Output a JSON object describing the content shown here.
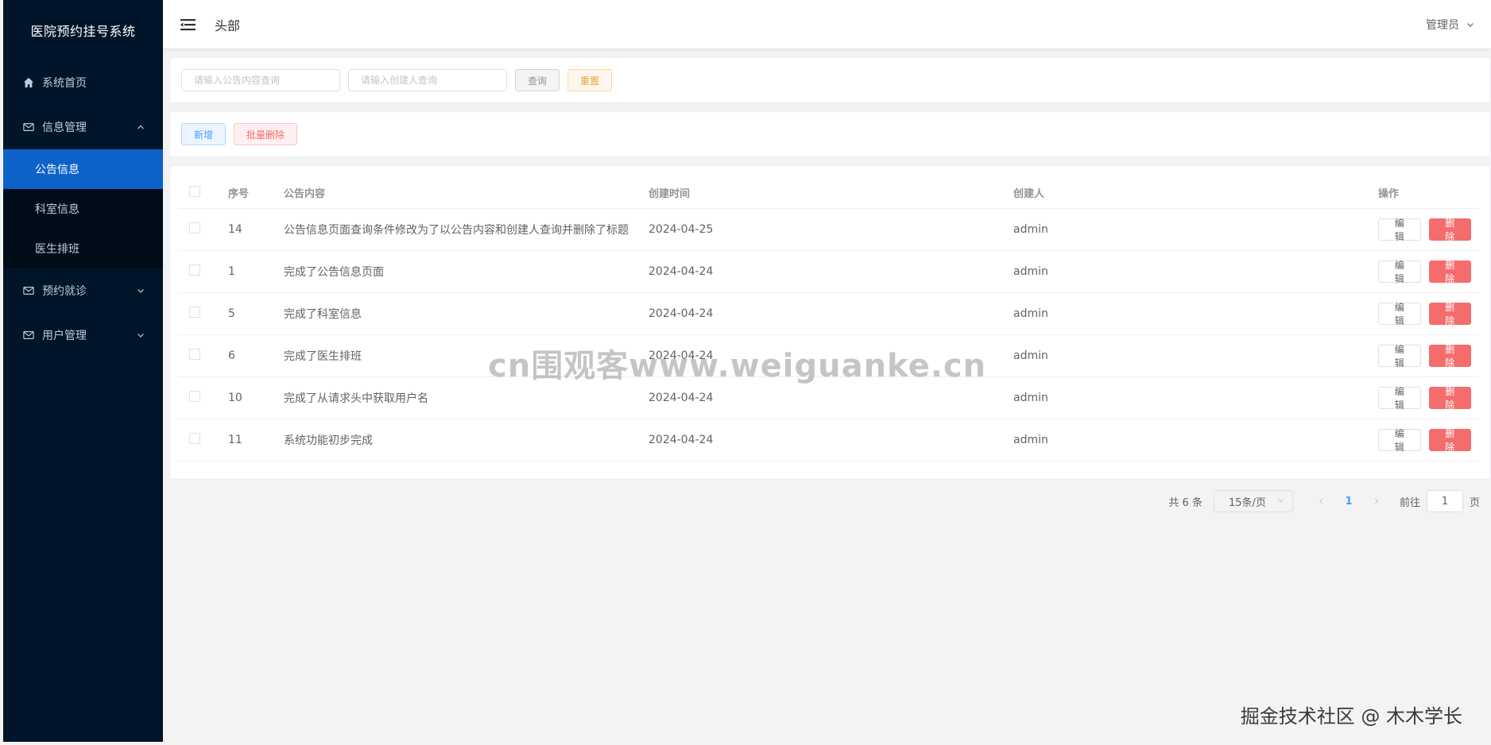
{
  "app": {
    "title": "医院预约挂号系统"
  },
  "sidebar": {
    "items": [
      {
        "label": "系统首页",
        "icon": "home-icon"
      },
      {
        "label": "信息管理",
        "icon": "mail-icon",
        "expanded": true,
        "children": [
          {
            "label": "公告信息",
            "active": true
          },
          {
            "label": "科室信息",
            "active": false
          },
          {
            "label": "医生排班",
            "active": false
          }
        ]
      },
      {
        "label": "预约就诊",
        "icon": "mail-icon",
        "expanded": false
      },
      {
        "label": "用户管理",
        "icon": "mail-icon",
        "expanded": false
      }
    ]
  },
  "header": {
    "title": "头部",
    "user_label": "管理员"
  },
  "search": {
    "content_placeholder": "请输入公告内容查询",
    "creator_placeholder": "请输入创建人查询",
    "query_label": "查询",
    "reset_label": "重置"
  },
  "actions": {
    "add_label": "新增",
    "batch_delete_label": "批量删除"
  },
  "table": {
    "headers": {
      "id": "序号",
      "content": "公告内容",
      "time": "创建时间",
      "creator": "创建人",
      "ops": "操作"
    },
    "edit_label": "编辑",
    "delete_label": "删除",
    "rows": [
      {
        "id": "14",
        "content": "公告信息页面查询条件修改为了以公告内容和创建人查询并删除了标题",
        "time": "2024-04-25",
        "creator": "admin"
      },
      {
        "id": "1",
        "content": "完成了公告信息页面",
        "time": "2024-04-24",
        "creator": "admin"
      },
      {
        "id": "5",
        "content": "完成了科室信息",
        "time": "2024-04-24",
        "creator": "admin"
      },
      {
        "id": "6",
        "content": "完成了医生排班",
        "time": "2024-04-24",
        "creator": "admin"
      },
      {
        "id": "10",
        "content": "完成了从请求头中获取用户名",
        "time": "2024-04-24",
        "creator": "admin"
      },
      {
        "id": "11",
        "content": "系统功能初步完成",
        "time": "2024-04-24",
        "creator": "admin"
      }
    ]
  },
  "pagination": {
    "total_text": "共 6 条",
    "page_size": "15条/页",
    "current_page": "1",
    "goto_prefix": "前往",
    "goto_value": "1",
    "goto_suffix": "页"
  },
  "watermarks": {
    "center": "cn围观客www.weiguanke.cn",
    "corner": "掘金技术社区 @ 木木学长"
  },
  "colors": {
    "sidebar_bg": "#001529",
    "active_menu": "#0d62c9",
    "primary": "#409eff",
    "danger": "#f56c6c",
    "warning": "#e6a23c"
  }
}
